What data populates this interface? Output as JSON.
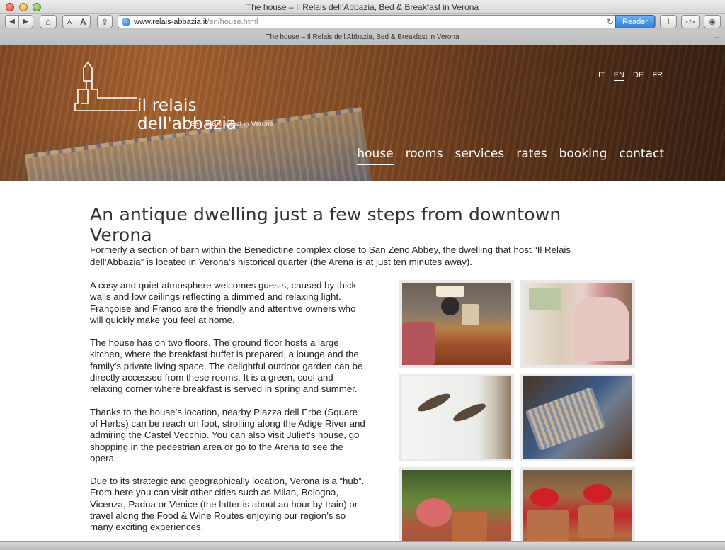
{
  "window": {
    "title": "The house – Il Relais dell’Abbazia, Bed & Breakfast in Verona",
    "tab_title": "The house – Il Relais dell'Abbazia, Bed & Breakfast in Verona"
  },
  "toolbar": {
    "back_glyph": "◀",
    "forward_glyph": "▶",
    "home_glyph": "⌂",
    "font_small": "A",
    "font_large": "A",
    "share_glyph": "⇪",
    "url_host": "www.relais-abbazia.it",
    "url_path": "/en/house.html",
    "reload_glyph": "↻",
    "reader_label": "Reader",
    "alert_glyph": "!",
    "devtools_glyph": "</>",
    "screenshot_glyph": "◉",
    "new_tab_glyph": "+"
  },
  "site": {
    "logo_name": "il relais dell'abbazia",
    "logo_tagline": "Bed & Breakfast in Verona",
    "languages": [
      "IT",
      "EN",
      "DE",
      "FR"
    ],
    "active_language": "EN",
    "nav": [
      "house",
      "rooms",
      "services",
      "rates",
      "booking",
      "contact"
    ],
    "active_nav": "house"
  },
  "content": {
    "heading": "An antique dwelling just a few steps from downtown Verona",
    "intro": "Formerly a section of barn within the Benedictine complex close to San Zeno Abbey, the dwelling that host “Il Relais dell’Abbazia” is located in Verona’s historical quarter (the Arena is at just ten minutes away).",
    "paragraphs": [
      "A cosy and quiet atmosphere welcomes guests, caused by thick walls and low ceilings reflecting a dimmed and relaxing light. Françoise and Franco are the friendly and attentive owners who will quickly make you feel at home.",
      "The house has on two floors. The ground floor hosts a large kitchen, where the breakfast buffet is prepared, a lounge and the family’s private living space. The delightful outdoor garden can be directly accessed from these rooms. It is a green, cool and relaxing corner where breakfast is served in spring and summer.",
      "Thanks to the house’s location, nearby Piazza dell Erbe (Square of Herbs) can be reach on foot, strolling along the Adige River and admiring the Castel Vecchio. You can also visit Juliet’s house, go shopping in the pedestrian area or go to the Arena to see the opera.",
      "Due to its strategic and geographically location, Verona is a “hub”. From here you can visit other cities such as Milan, Bologna, Vicenza, Padua or Venice (the latter is about an hour by train) or travel along the Food & Wine Routes enjoying our region’s so many exciting experiences."
    ]
  },
  "colors": {
    "reader_button": "#2f7fd8",
    "header_wood": "#9a5a2b",
    "text": "#222222"
  }
}
